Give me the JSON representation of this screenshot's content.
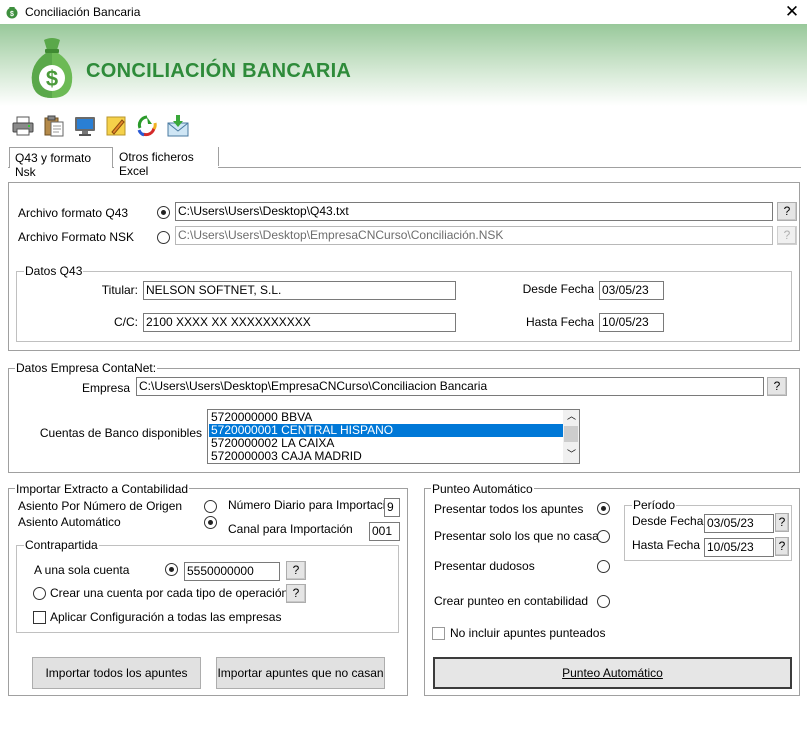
{
  "window": {
    "title": "Conciliación Bancaria",
    "close_glyph": "✕",
    "app_icon": "money-bag-icon"
  },
  "banner": {
    "heading": "CONCILIACIÓN BANCARIA",
    "logo_glyph": "$",
    "brand_color": "#2e8b3a"
  },
  "toolbar": {
    "icons": [
      "printer-icon",
      "clipboard-icon",
      "monitor-icon",
      "note-icon",
      "recycle-icon",
      "mail-download-icon"
    ]
  },
  "tabs": [
    {
      "label": "Q43 y formato Nsk",
      "selected": true
    },
    {
      "label": "Otros ficheros Excel",
      "selected": false
    }
  ],
  "files": {
    "q43_label": "Archivo formato Q43",
    "q43_path": "C:\\Users\\Users\\Desktop\\Q43.txt",
    "nsk_label": "Archivo Formato NSK",
    "nsk_path": "C:\\Users\\Users\\Desktop\\EmpresaCNCurso\\Conciliación.NSK",
    "browse_label": "?"
  },
  "datos_q43": {
    "legend": "Datos Q43",
    "titular_label": "Titular:",
    "titular_value": "NELSON SOFTNET, S.L.",
    "cc_label": "C/C:",
    "cc_value": "2100 XXXX XX XXXXXXXXXX",
    "desde_label": "Desde Fecha",
    "desde_value": "03/05/23",
    "hasta_label": "Hasta Fecha",
    "hasta_value": "10/05/23"
  },
  "empresa": {
    "legend": "Datos Empresa ContaNet:",
    "empresa_label": "Empresa",
    "empresa_path": "C:\\Users\\Users\\Desktop\\EmpresaCNCurso\\Conciliacion Bancaria",
    "cuentas_label": "Cuentas de Banco disponibles",
    "cuentas": [
      "5720000000 BBVA",
      "5720000001 CENTRAL HISPANO",
      "5720000002 LA CAIXA",
      "5720000003 CAJA MADRID"
    ],
    "selected_index": 1
  },
  "importar": {
    "legend": "Importar Extracto a Contabilidad",
    "origen_label": "Asiento Por Número de Origen",
    "automatico_label": "Asiento Automático",
    "diario_label": "Número Diario para Importación",
    "diario_value": "9",
    "canal_label": "Canal para Importación",
    "canal_value": "001",
    "contrapartida_legend": "Contrapartida",
    "una_cuenta_label": "A una sola cuenta",
    "una_cuenta_value": "5550000000",
    "crear_cuenta_label": "Crear una cuenta por cada tipo de operación",
    "aplicar_label": "Aplicar Configuración a todas las empresas",
    "btn_todos": "Importar todos los apuntes",
    "btn_no_casan": "Importar apuntes que no casan"
  },
  "punteo": {
    "legend": "Punteo Automático",
    "opt_todos": "Presentar todos los apuntes",
    "opt_no_casan": "Presentar solo los que no casan",
    "opt_dudosos": "Presentar dudosos",
    "opt_crear": "Crear punteo en contabilidad",
    "periodo_legend": "Período",
    "desde_label": "Desde Fecha",
    "desde_value": "03/05/23",
    "hasta_label": "Hasta Fecha",
    "hasta_value": "10/05/23",
    "no_incluir_label": "No incluir apuntes punteados",
    "btn_punteo": "Punteo Automático"
  }
}
